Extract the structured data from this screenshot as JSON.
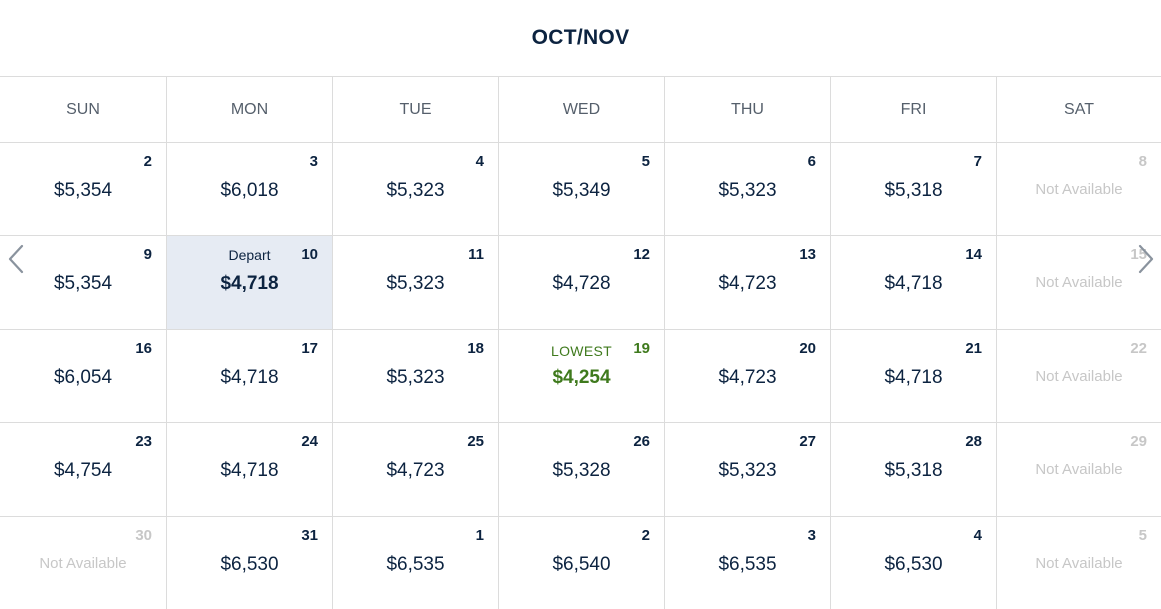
{
  "header": {
    "month_title": "OCT/NOV"
  },
  "weekdays": [
    "SUN",
    "MON",
    "TUE",
    "WED",
    "THU",
    "FRI",
    "SAT"
  ],
  "not_available_label": "Not Available",
  "weeks": [
    [
      {
        "day": "2",
        "price": "$5,354"
      },
      {
        "day": "3",
        "price": "$6,018"
      },
      {
        "day": "4",
        "price": "$5,323"
      },
      {
        "day": "5",
        "price": "$5,349"
      },
      {
        "day": "6",
        "price": "$5,323"
      },
      {
        "day": "7",
        "price": "$5,318"
      },
      {
        "day": "8",
        "price": "Not Available",
        "status": "unavailable"
      }
    ],
    [
      {
        "day": "9",
        "price": "$5,354"
      },
      {
        "day": "10",
        "price": "$4,718",
        "status": "selected",
        "tag": "Depart"
      },
      {
        "day": "11",
        "price": "$5,323"
      },
      {
        "day": "12",
        "price": "$4,728"
      },
      {
        "day": "13",
        "price": "$4,723"
      },
      {
        "day": "14",
        "price": "$4,718"
      },
      {
        "day": "15",
        "price": "Not Available",
        "status": "unavailable"
      }
    ],
    [
      {
        "day": "16",
        "price": "$6,054"
      },
      {
        "day": "17",
        "price": "$4,718"
      },
      {
        "day": "18",
        "price": "$5,323"
      },
      {
        "day": "19",
        "price": "$4,254",
        "status": "lowest",
        "tag": "LOWEST"
      },
      {
        "day": "20",
        "price": "$4,723"
      },
      {
        "day": "21",
        "price": "$4,718"
      },
      {
        "day": "22",
        "price": "Not Available",
        "status": "unavailable"
      }
    ],
    [
      {
        "day": "23",
        "price": "$4,754"
      },
      {
        "day": "24",
        "price": "$4,718"
      },
      {
        "day": "25",
        "price": "$4,723"
      },
      {
        "day": "26",
        "price": "$5,328"
      },
      {
        "day": "27",
        "price": "$5,323"
      },
      {
        "day": "28",
        "price": "$5,318"
      },
      {
        "day": "29",
        "price": "Not Available",
        "status": "unavailable"
      }
    ],
    [
      {
        "day": "30",
        "price": "Not Available",
        "status": "unavailable"
      },
      {
        "day": "31",
        "price": "$6,530"
      },
      {
        "day": "1",
        "price": "$6,535"
      },
      {
        "day": "2",
        "price": "$6,540"
      },
      {
        "day": "3",
        "price": "$6,535"
      },
      {
        "day": "4",
        "price": "$6,530"
      },
      {
        "day": "5",
        "price": "Not Available",
        "status": "unavailable"
      }
    ]
  ],
  "navigation": {
    "prev_icon": "chevron-left-icon",
    "next_icon": "chevron-right-icon"
  },
  "colors": {
    "text_primary": "#0c2340",
    "lowest_green": "#3f7a1d",
    "selected_bg": "#e6ebf3",
    "unavailable_gray": "#c7c7c7"
  }
}
